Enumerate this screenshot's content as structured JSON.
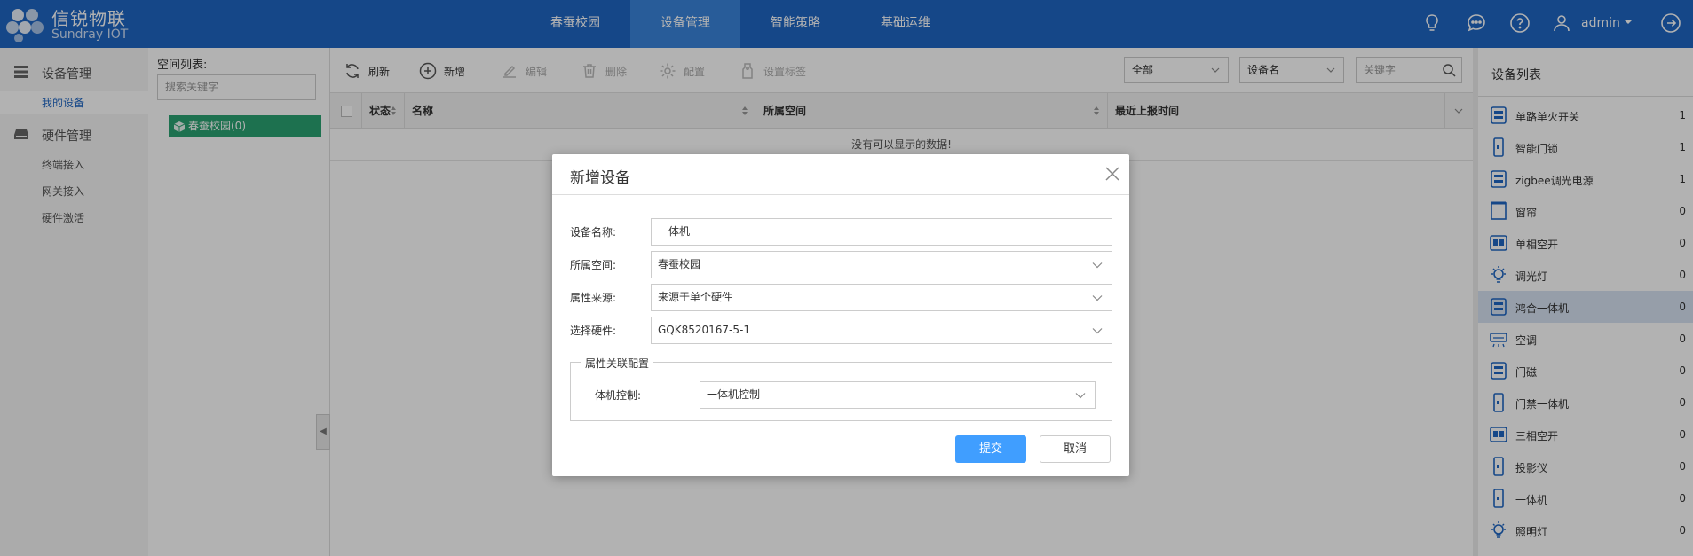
{
  "header": {
    "brand_cn": "信锐物联",
    "brand_en": "Sundray IOT",
    "nav": [
      {
        "label": "春蚕校园",
        "active": false
      },
      {
        "label": "设备管理",
        "active": true
      },
      {
        "label": "智能策略",
        "active": false
      },
      {
        "label": "基础运维",
        "active": false
      }
    ],
    "user": "admin",
    "icons": [
      "lightbulb-icon",
      "chat-icon",
      "help-icon",
      "user-icon",
      "logout-icon"
    ]
  },
  "sidebar": {
    "groups": [
      {
        "label": "设备管理",
        "icon": "list-icon",
        "items": [
          {
            "label": "我的设备",
            "active": true
          }
        ]
      },
      {
        "label": "硬件管理",
        "icon": "hardware-icon",
        "items": [
          {
            "label": "终端接入",
            "active": false
          },
          {
            "label": "网关接入",
            "active": false
          },
          {
            "label": "硬件激活",
            "active": false
          }
        ]
      }
    ]
  },
  "space": {
    "title": "空间列表:",
    "search_placeholder": "搜索关键字",
    "node": "春蚕校园(0)"
  },
  "toolbar": {
    "refresh": "刷新",
    "add": "新增",
    "edit": "编辑",
    "delete": "删除",
    "config": "配置",
    "set_tag": "设置标签",
    "filter_all": "全部",
    "filter_field": "设备名",
    "keyword_placeholder": "关键字"
  },
  "grid": {
    "columns": [
      "状态",
      "名称",
      "所属空间",
      "最近上报时间"
    ],
    "empty_text": "没有可以显示的数据!"
  },
  "device_list": {
    "title": "设备列表",
    "items": [
      {
        "name": "单路单火开关",
        "count": "1",
        "icon": "switch-icon",
        "active": false
      },
      {
        "name": "智能门锁",
        "count": "1",
        "icon": "door-lock-icon",
        "active": false
      },
      {
        "name": "zigbee调光电源",
        "count": "1",
        "icon": "dimmer-power-icon",
        "active": false
      },
      {
        "name": "窗帘",
        "count": "0",
        "icon": "curtain-icon",
        "active": false
      },
      {
        "name": "单相空开",
        "count": "0",
        "icon": "breaker-icon",
        "active": false
      },
      {
        "name": "调光灯",
        "count": "0",
        "icon": "dimmable-light-icon",
        "active": false
      },
      {
        "name": "鸿合一体机",
        "count": "0",
        "icon": "all-in-one-icon",
        "active": true
      },
      {
        "name": "空调",
        "count": "0",
        "icon": "air-conditioner-icon",
        "active": false
      },
      {
        "name": "门磁",
        "count": "0",
        "icon": "door-sensor-icon",
        "active": false
      },
      {
        "name": "门禁一体机",
        "count": "0",
        "icon": "access-control-icon",
        "active": false
      },
      {
        "name": "三相空开",
        "count": "0",
        "icon": "three-phase-breaker-icon",
        "active": false
      },
      {
        "name": "投影仪",
        "count": "0",
        "icon": "projector-icon",
        "active": false
      },
      {
        "name": "一体机",
        "count": "0",
        "icon": "terminal-icon",
        "active": false
      },
      {
        "name": "照明灯",
        "count": "0",
        "icon": "lighting-icon",
        "active": false
      }
    ]
  },
  "dialog": {
    "title": "新增设备",
    "fields": [
      {
        "label": "设备名称:",
        "value": "一体机",
        "type": "text"
      },
      {
        "label": "所属空间:",
        "value": "春蚕校园",
        "type": "select"
      },
      {
        "label": "属性来源:",
        "value": "来源于单个硬件",
        "type": "select"
      },
      {
        "label": "选择硬件:",
        "value": "GQK8520167-5-1",
        "type": "select"
      }
    ],
    "fieldset_legend": "属性关联配置",
    "assoc_label": "一体机控制:",
    "assoc_value": "一体机控制",
    "submit": "提交",
    "cancel": "取消"
  },
  "colors": {
    "header_bg": "#1f66c3",
    "nav_active": "#3a84db",
    "space_node": "#2aa371",
    "primary_button": "#409eff",
    "active_row": "#d7e3f3"
  }
}
